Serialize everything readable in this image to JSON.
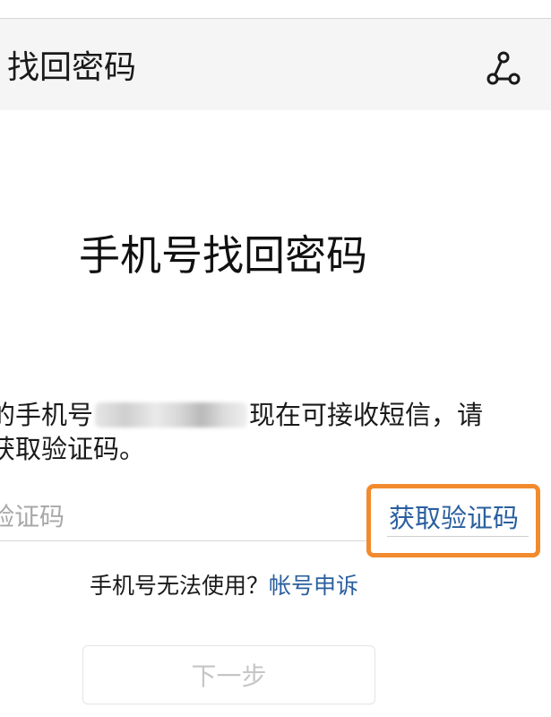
{
  "header": {
    "title": "找回密码",
    "share_icon": "share-icon"
  },
  "main": {
    "title": "手机号找回密码",
    "description": {
      "line1_prefix": "的手机号",
      "line1_suffix": "现在可接收短信，请",
      "line2": "获取验证码。"
    },
    "code_input": {
      "placeholder": "验证码",
      "value": ""
    },
    "get_code_label": "获取验证码",
    "appeal": {
      "text": "手机号无法使用？",
      "link_label": "帐号申诉"
    },
    "next_label": "下一步"
  },
  "colors": {
    "link": "#2a5f9e",
    "highlight": "#f28a2e",
    "disabled_text": "#c6c6c6"
  }
}
